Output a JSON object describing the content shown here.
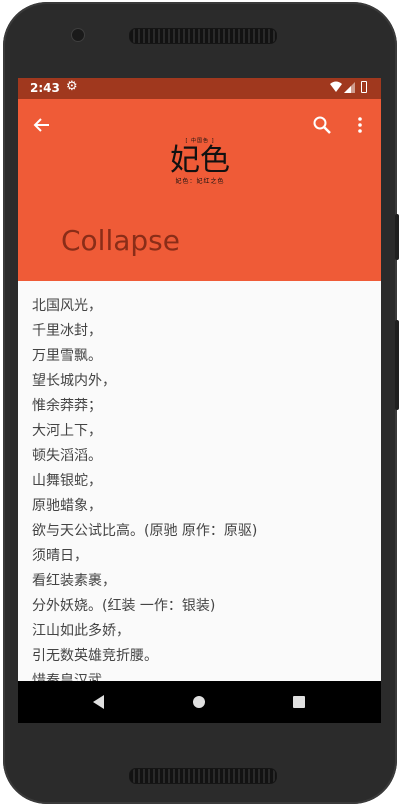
{
  "status_bar": {
    "time": "2:43",
    "icons": [
      "settings-icon",
      "wifi-icon",
      "signal-icon",
      "battery-icon"
    ]
  },
  "toolbar": {
    "actions": [
      "back-arrow-icon",
      "search-icon",
      "more-vert-icon"
    ],
    "logo": {
      "tag": "[ 中国色 ]",
      "name": "妃色",
      "subtitle": "妃色：妃红之色"
    },
    "collapse_title": "Collapse",
    "background_color": "#ef5b37",
    "status_color": "#a0381e"
  },
  "poem_lines": [
    "北国风光，",
    "千里冰封，",
    "万里雪飘。",
    "望长城内外，",
    "惟余莽莽；",
    "大河上下，",
    "顿失滔滔。",
    "山舞银蛇，",
    "原驰蜡象，",
    "欲与天公试比高。(原驰 原作：原驱)",
    "须晴日，",
    "看红装素裹，",
    "分外妖娆。(红装 一作：银装)",
    "江山如此多娇，",
    "引无数英雄竞折腰。",
    "惜秦皇汉武，"
  ],
  "nav_bar": {
    "buttons": [
      "back-triangle-icon",
      "home-circle-icon",
      "recents-square-icon"
    ]
  }
}
